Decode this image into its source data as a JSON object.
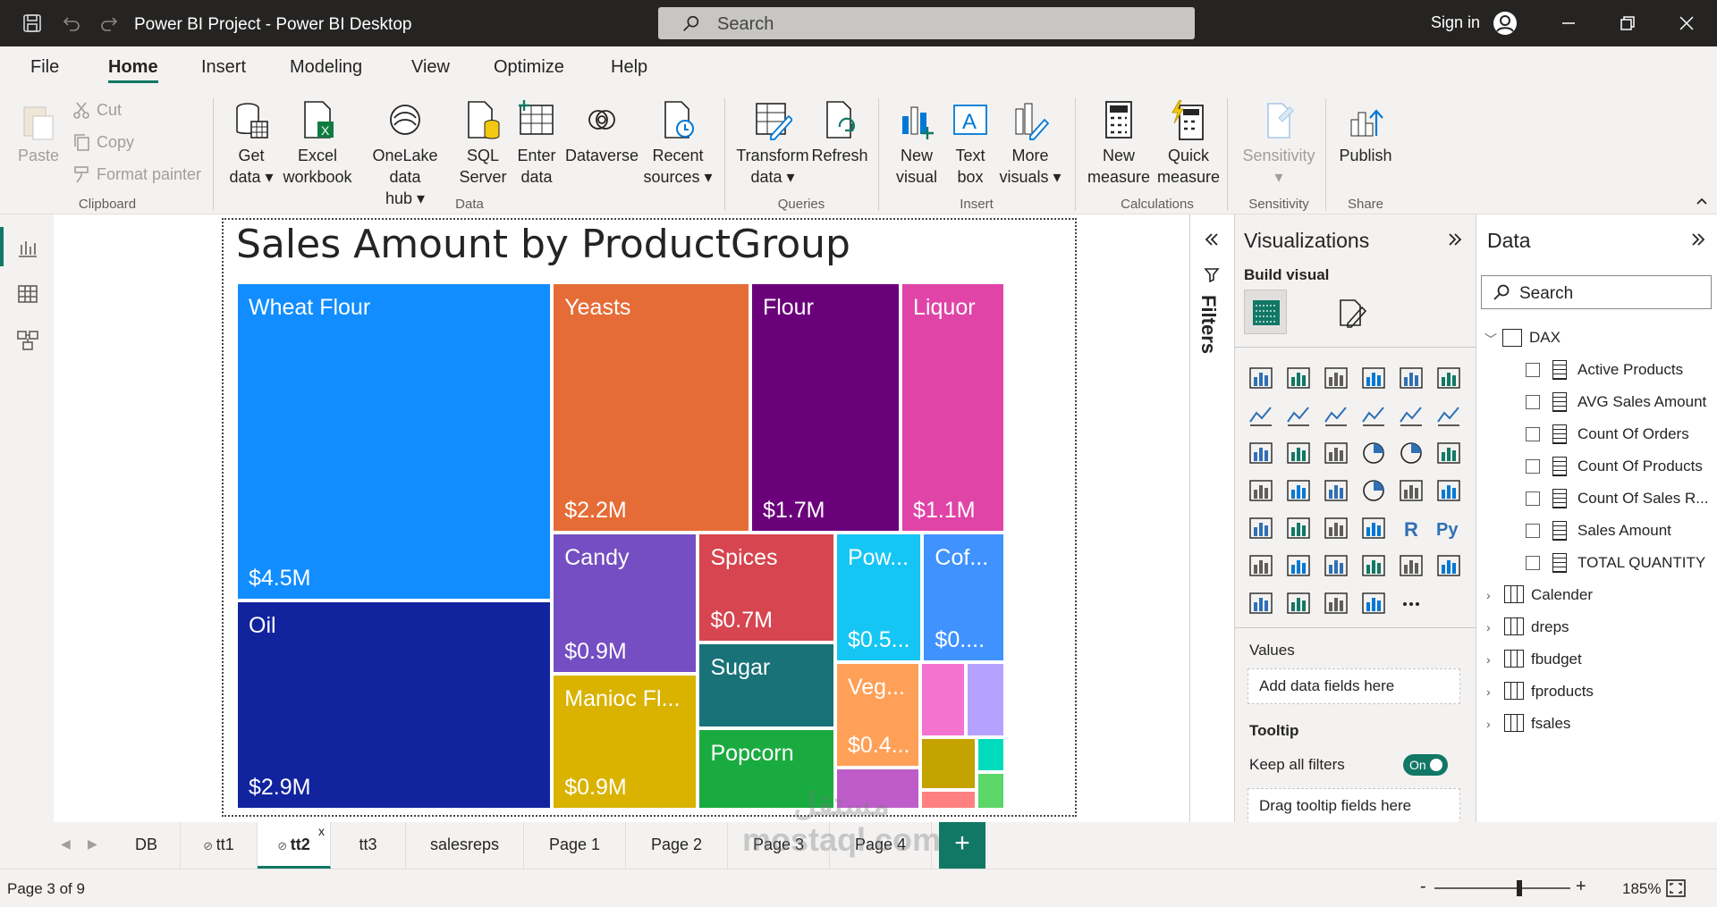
{
  "titlebar": {
    "title": "Power BI Project - Power BI Desktop",
    "search": "Search",
    "signin": "Sign in"
  },
  "menu": [
    "File",
    "Home",
    "Insert",
    "Modeling",
    "View",
    "Optimize",
    "Help"
  ],
  "ribbon": {
    "clipboard": {
      "paste": "Paste",
      "cut": "Cut",
      "copy": "Copy",
      "format_painter": "Format painter",
      "label": "Clipboard"
    },
    "data": {
      "get_data": [
        "Get",
        "data"
      ],
      "excel": [
        "Excel",
        "workbook"
      ],
      "onelake": [
        "OneLake data",
        "hub"
      ],
      "sql": [
        "SQL",
        "Server"
      ],
      "enter": [
        "Enter",
        "data"
      ],
      "dataverse": "Dataverse",
      "recent": [
        "Recent",
        "sources"
      ],
      "label": "Data"
    },
    "queries": {
      "transform": [
        "Transform",
        "data"
      ],
      "refresh": "Refresh",
      "label": "Queries"
    },
    "insert": {
      "new_visual": [
        "New",
        "visual"
      ],
      "text_box": [
        "Text",
        "box"
      ],
      "more_visuals": [
        "More",
        "visuals"
      ],
      "label": "Insert"
    },
    "calculations": {
      "new_measure": [
        "New",
        "measure"
      ],
      "quick_measure": [
        "Quick",
        "measure"
      ],
      "label": "Calculations"
    },
    "sensitivity": {
      "btn": "Sensitivity",
      "label": "Sensitivity"
    },
    "share": {
      "publish": "Publish",
      "label": "Share"
    }
  },
  "visual": {
    "title": "Sales Amount by ProductGroup"
  },
  "chart_data": {
    "type": "treemap",
    "title": "Sales Amount by ProductGroup",
    "tiles": [
      {
        "name": "Wheat Flour",
        "label": "$4.5M",
        "value": 4.5,
        "color": "#118dff"
      },
      {
        "name": "Oil",
        "label": "$2.9M",
        "value": 2.9,
        "color": "#12239e"
      },
      {
        "name": "Yeasts",
        "label": "$2.2M",
        "value": 2.2,
        "color": "#e66c37"
      },
      {
        "name": "Flour",
        "label": "$1.7M",
        "value": 1.7,
        "color": "#6b007b"
      },
      {
        "name": "Liquor",
        "label": "$1.1M",
        "value": 1.1,
        "color": "#e044a7"
      },
      {
        "name": "Candy",
        "label": "$0.9M",
        "value": 0.9,
        "color": "#744ec2"
      },
      {
        "name": "Manioc Fl...",
        "label": "$0.9M",
        "value": 0.9,
        "color": "#d9b300"
      },
      {
        "name": "Spices",
        "label": "$0.7M",
        "value": 0.7,
        "color": "#d64550"
      },
      {
        "name": "Sugar",
        "label": "",
        "color": "#197278"
      },
      {
        "name": "Popcorn",
        "label": "",
        "color": "#1aab40"
      },
      {
        "name": "Pow...",
        "label": "$0.5...",
        "color": "#15c6f4"
      },
      {
        "name": "Cof...",
        "label": "$0....",
        "color": "#4092ff"
      },
      {
        "name": "Veg...",
        "label": "$0.4...",
        "color": "#ffa058"
      },
      {
        "name": "",
        "label": "",
        "color": "#be5dc9"
      },
      {
        "name": "",
        "label": "",
        "color": "#f472d0"
      },
      {
        "name": "",
        "label": "",
        "color": "#b5a1ff"
      },
      {
        "name": "",
        "label": "",
        "color": "#c4a200"
      },
      {
        "name": "",
        "label": "",
        "color": "#ff8080"
      },
      {
        "name": "",
        "label": "",
        "color": "#00dbbc"
      },
      {
        "name": "",
        "label": "",
        "color": "#5bd667"
      }
    ]
  },
  "filters": {
    "label": "Filters"
  },
  "viz": {
    "title": "Visualizations",
    "build": "Build visual",
    "values_label": "Values",
    "values_ph": "Add data fields here",
    "tooltip_label": "Tooltip",
    "keep_filters": "Keep all filters",
    "toggle": "On",
    "drag_ph": "Drag tooltip fields here"
  },
  "data_pane": {
    "title": "Data",
    "search": "Search",
    "dax": "DAX",
    "measures": [
      "Active Products",
      "AVG Sales Amount",
      "Count Of Orders",
      "Count Of Products",
      "Count Of Sales R...",
      "Sales Amount",
      "TOTAL QUANTITY"
    ],
    "tables": [
      "Calender",
      "dreps",
      "fbudget",
      "fproducts",
      "fsales"
    ]
  },
  "pages": [
    "DB",
    "tt1",
    "tt2",
    "tt3",
    "salesreps",
    "Page 1",
    "Page 2",
    "Page 3",
    "Page 4"
  ],
  "status": {
    "page": "Page 3 of 9",
    "zoom": "185%"
  },
  "watermark": [
    "مستقل",
    "mostaql.com"
  ]
}
